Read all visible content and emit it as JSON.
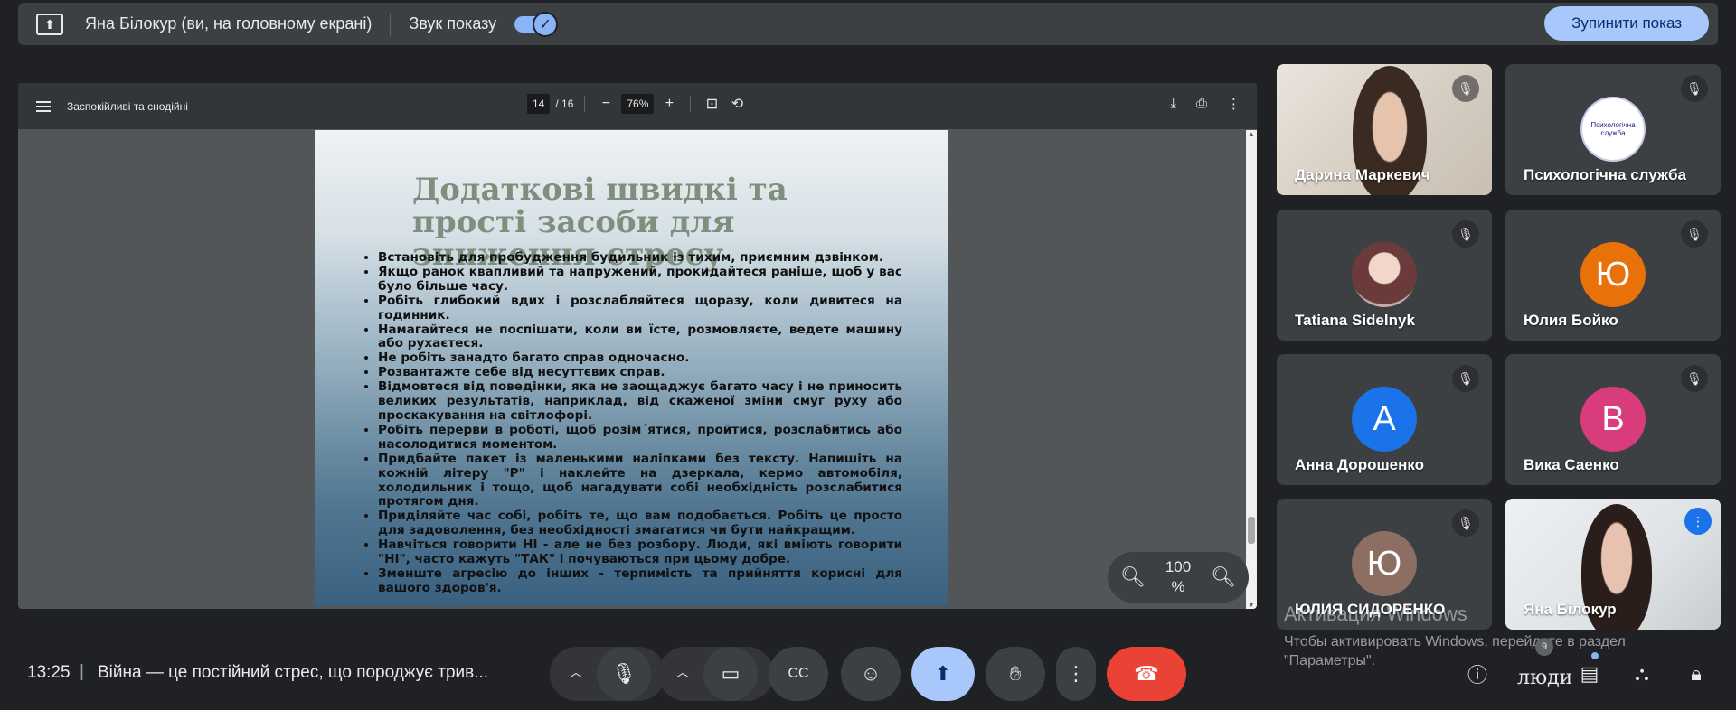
{
  "topbar": {
    "presenting_label": "Яна Білокур (ви, на головному екрані)",
    "sound_label": "Звук показу",
    "sound_enabled": true,
    "stop_button": "Зупинити показ"
  },
  "pdf": {
    "doc_title": "Заспокійливі та снодійні",
    "page_current": "14",
    "page_total": "/ 16",
    "zoom": "76%",
    "slide_title": "Додаткові швидкі та прості засоби для зниження стресу",
    "bullets": [
      "Встановіть для пробудження будильник із тихим, приємним дзвінком.",
      "Якщо ранок квапливий та напружений, прокидайтеся раніше, щоб у вас було більше часу.",
      "Робіть глибокий вдих і розслабляйтеся щоразу, коли дивитеся на годинник.",
      "Намагайтеся не поспішати, коли ви їсте, розмовляєте, ведете машину або рухаєтеся.",
      "Не робіть занадто багато справ одночасно.",
      "Розвантажте себе від несуттєвих справ.",
      "Відмовтеся від поведінки, яка не заощаджує багато часу і не приносить великих результатів, наприклад, від скаженої зміни смуг руху або проскакування на світлофорі.",
      "Робіть перерви в роботі, щоб розім´ятися, пройтися, розслабитись або насолодитися моментом.",
      "Придбайте пакет із маленькими наліпками без тексту. Напишіть на кожній літеру \"Р\" і наклейте на дзеркала, кермо автомобіля, холодильник і тощо, щоб нагадувати собі необхідність розслабитися протягом дня.",
      "Приділяйте час собі, робіть те, що вам подобається. Робіть це просто для задоволення, без необхідності змагатися чи бути найкращим.",
      "Навчіться говорити НІ - але не без розбору. Люди, які вміють говорити \"НІ\", часто кажуть \"ТАК\" і почуваються при цьому добре.",
      "Зменште агресію до інших - терпимість та прийняття корисні для вашого здоров'я."
    ],
    "zoom_overlay": "100\n%",
    "scroll_position": 0.83
  },
  "participants": [
    {
      "name": "Дарина Маркевич",
      "type": "video",
      "muted": true
    },
    {
      "name": "Психологічна служба",
      "type": "logo",
      "muted": true,
      "logo_text": "Психологічна служба"
    },
    {
      "name": "Tatiana Sidelnyk",
      "type": "photo",
      "muted": true
    },
    {
      "name": "Юлия Бойко",
      "type": "letter",
      "letter": "Ю",
      "color": "#e8710a",
      "muted": true
    },
    {
      "name": "Анна Дорошенко",
      "type": "letter",
      "letter": "А",
      "color": "#1a73e8",
      "muted": true
    },
    {
      "name": "Вика Саенко",
      "type": "letter",
      "letter": "В",
      "color": "#d93c7c",
      "muted": true
    },
    {
      "name": "ЮЛИЯ СИДОРЕНКО",
      "type": "letter",
      "letter": "Ю",
      "color": "#8d6e63",
      "muted": true
    },
    {
      "name": "Яна Білокур",
      "type": "video",
      "speaking": true
    }
  ],
  "watermark": {
    "title": "Активация Windows",
    "subtitle": "Чтобы активировать Windows, перейдите в раздел \"Параметры\"."
  },
  "bottombar": {
    "time": "13:25",
    "separator": "|",
    "meeting_title": "Війна — це постійний стрес, що породжує трив...",
    "people_label": "люди",
    "people_count": "9"
  },
  "colors": {
    "background": "#202124",
    "surface": "#3c4043",
    "accent": "#a8c7fa",
    "end_call": "#ea4335"
  }
}
